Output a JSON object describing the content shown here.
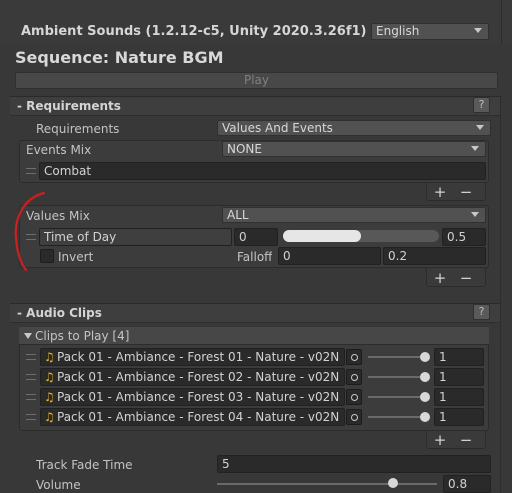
{
  "title": "Ambient Sounds (1.2.12-c5, Unity 2020.3.26f1)",
  "language": "English",
  "sequence_title": "Sequence: Nature BGM",
  "play_label": "Play",
  "requirements": {
    "header": "- Requirements",
    "help": "?",
    "label": "Requirements",
    "value": "Values And Events",
    "events_mix_label": "Events Mix",
    "events_mix_value": "NONE",
    "events": [
      "Combat"
    ],
    "values_mix_label": "Values Mix",
    "values_mix_value": "ALL",
    "value_item": {
      "name": "Time of Day",
      "min": "0",
      "max": "0.5",
      "fill_fraction": 0.5,
      "invert_label": "Invert",
      "falloff_label": "Falloff",
      "falloff_min": "0",
      "falloff_max": "0.2"
    }
  },
  "audio_clips": {
    "header": "- Audio Clips",
    "help": "?",
    "list_label": "Clips to Play [4]",
    "clips": [
      {
        "name": "Pack 01 - Ambiance - Forest 01 - Nature - v02N",
        "volume": "1"
      },
      {
        "name": "Pack 01 - Ambiance - Forest 02 - Nature - v02N",
        "volume": "1"
      },
      {
        "name": "Pack 01 - Ambiance - Forest 03 - Nature - v02N",
        "volume": "1"
      },
      {
        "name": "Pack 01 - Ambiance - Forest 04 - Nature - v02N",
        "volume": "1"
      }
    ],
    "track_fade_label": "Track Fade Time",
    "track_fade_value": "5",
    "volume_label": "Volume",
    "volume_value": "0.8",
    "volume_fraction": 0.8
  },
  "list_controls": {
    "plus": "+",
    "minus": "−"
  },
  "icons": {
    "clip": "music-note-icon",
    "target": "object-picker-icon",
    "grip": "drag-handle-icon",
    "foldout": "triangle-down-icon"
  },
  "colors": {
    "background": "#383838",
    "field": "#2a2a2a",
    "annotation": "#cc1f1f",
    "clip_icon": "#e8b32a"
  }
}
